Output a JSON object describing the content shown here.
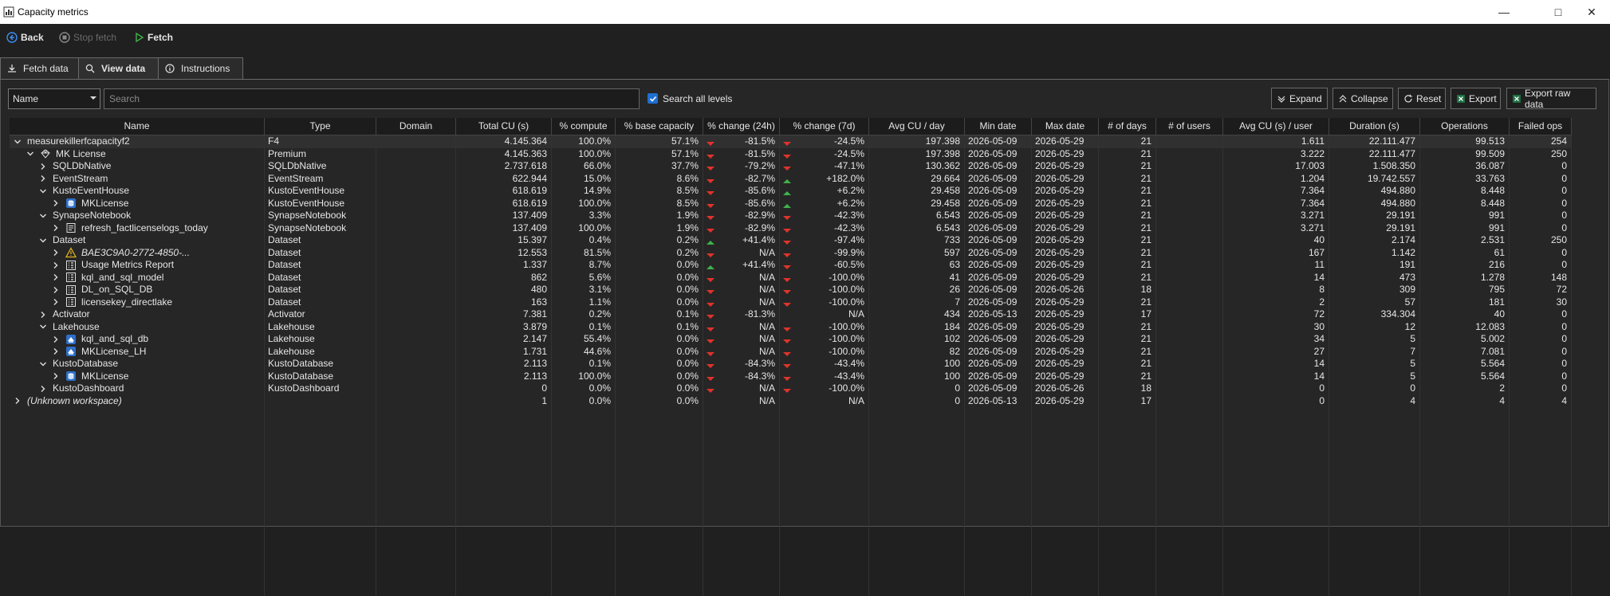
{
  "window": {
    "title": "Capacity metrics"
  },
  "toolbar": {
    "back": "Back",
    "stop_fetch": "Stop fetch",
    "fetch": "Fetch"
  },
  "tabs": [
    {
      "label": "Fetch data"
    },
    {
      "label": "View data"
    },
    {
      "label": "Instructions"
    }
  ],
  "filter": {
    "field": "Name",
    "search_placeholder": "Search",
    "search_all_levels_label": "Search all levels",
    "search_all_levels_checked": true
  },
  "actions": {
    "expand": "Expand",
    "collapse": "Collapse",
    "reset": "Reset",
    "export": "Export",
    "export_raw": "Export raw data"
  },
  "columns": [
    "Name",
    "Type",
    "Domain",
    "Total CU (s)",
    "% compute",
    "% base capacity",
    "% change (24h)",
    "% change (7d)",
    "Avg CU / day",
    "Min date",
    "Max date",
    "# of days",
    "# of users",
    "Avg CU (s) / user",
    "Duration (s)",
    "Operations",
    "Failed ops"
  ],
  "rows": [
    {
      "name": "measurekillerfcapacityf2",
      "type": "F4",
      "domain": "",
      "total_cu": "4.145.364",
      "pct_compute": "100.0%",
      "pct_base": "57.1%",
      "chg24": "-81.5%",
      "chg24_dir": "down",
      "chg7": "-24.5%",
      "chg7_dir": "down",
      "avg_cu_day": "197.398",
      "min_date": "2026-05-09",
      "max_date": "2026-05-29",
      "days": "21",
      "users": "",
      "avg_cu_user": "1.611",
      "duration": "22.111.477",
      "operations": "99.513",
      "failed": "254"
    },
    {
      "name": "MK License",
      "type": "Premium",
      "domain": "",
      "total_cu": "4.145.363",
      "pct_compute": "100.0%",
      "pct_base": "57.1%",
      "chg24": "-81.5%",
      "chg24_dir": "down",
      "chg7": "-24.5%",
      "chg7_dir": "down",
      "avg_cu_day": "197.398",
      "min_date": "2026-05-09",
      "max_date": "2026-05-29",
      "days": "21",
      "users": "",
      "avg_cu_user": "3.222",
      "duration": "22.111.477",
      "operations": "99.509",
      "failed": "250"
    },
    {
      "name": "SQLDbNative",
      "type": "SQLDbNative",
      "domain": "",
      "total_cu": "2.737.618",
      "pct_compute": "66.0%",
      "pct_base": "37.7%",
      "chg24": "-79.2%",
      "chg24_dir": "down",
      "chg7": "-47.1%",
      "chg7_dir": "down",
      "avg_cu_day": "130.362",
      "min_date": "2026-05-09",
      "max_date": "2026-05-29",
      "days": "21",
      "users": "",
      "avg_cu_user": "17.003",
      "duration": "1.508.350",
      "operations": "36.087",
      "failed": "0"
    },
    {
      "name": "EventStream",
      "type": "EventStream",
      "domain": "",
      "total_cu": "622.944",
      "pct_compute": "15.0%",
      "pct_base": "8.6%",
      "chg24": "-82.7%",
      "chg24_dir": "down",
      "chg7": "+182.0%",
      "chg7_dir": "up",
      "avg_cu_day": "29.664",
      "min_date": "2026-05-09",
      "max_date": "2026-05-29",
      "days": "21",
      "users": "",
      "avg_cu_user": "1.204",
      "duration": "19.742.557",
      "operations": "33.763",
      "failed": "0"
    },
    {
      "name": "KustoEventHouse",
      "type": "KustoEventHouse",
      "domain": "",
      "total_cu": "618.619",
      "pct_compute": "14.9%",
      "pct_base": "8.5%",
      "chg24": "-85.6%",
      "chg24_dir": "down",
      "chg7": "+6.2%",
      "chg7_dir": "up",
      "avg_cu_day": "29.458",
      "min_date": "2026-05-09",
      "max_date": "2026-05-29",
      "days": "21",
      "users": "",
      "avg_cu_user": "7.364",
      "duration": "494.880",
      "operations": "8.448",
      "failed": "0"
    },
    {
      "name": "MKLicense",
      "type": "KustoEventHouse",
      "domain": "",
      "total_cu": "618.619",
      "pct_compute": "100.0%",
      "pct_base": "8.5%",
      "chg24": "-85.6%",
      "chg24_dir": "down",
      "chg7": "+6.2%",
      "chg7_dir": "up",
      "avg_cu_day": "29.458",
      "min_date": "2026-05-09",
      "max_date": "2026-05-29",
      "days": "21",
      "users": "",
      "avg_cu_user": "7.364",
      "duration": "494.880",
      "operations": "8.448",
      "failed": "0"
    },
    {
      "name": "SynapseNotebook",
      "type": "SynapseNotebook",
      "domain": "",
      "total_cu": "137.409",
      "pct_compute": "3.3%",
      "pct_base": "1.9%",
      "chg24": "-82.9%",
      "chg24_dir": "down",
      "chg7": "-42.3%",
      "chg7_dir": "down",
      "avg_cu_day": "6.543",
      "min_date": "2026-05-09",
      "max_date": "2026-05-29",
      "days": "21",
      "users": "",
      "avg_cu_user": "3.271",
      "duration": "29.191",
      "operations": "991",
      "failed": "0"
    },
    {
      "name": "refresh_factlicenselogs_today",
      "type": "SynapseNotebook",
      "domain": "",
      "total_cu": "137.409",
      "pct_compute": "100.0%",
      "pct_base": "1.9%",
      "chg24": "-82.9%",
      "chg24_dir": "down",
      "chg7": "-42.3%",
      "chg7_dir": "down",
      "avg_cu_day": "6.543",
      "min_date": "2026-05-09",
      "max_date": "2026-05-29",
      "days": "21",
      "users": "",
      "avg_cu_user": "3.271",
      "duration": "29.191",
      "operations": "991",
      "failed": "0"
    },
    {
      "name": "Dataset",
      "type": "Dataset",
      "domain": "",
      "total_cu": "15.397",
      "pct_compute": "0.4%",
      "pct_base": "0.2%",
      "chg24": "+41.4%",
      "chg24_dir": "up",
      "chg7": "-97.4%",
      "chg7_dir": "down",
      "avg_cu_day": "733",
      "min_date": "2026-05-09",
      "max_date": "2026-05-29",
      "days": "21",
      "users": "",
      "avg_cu_user": "40",
      "duration": "2.174",
      "operations": "2.531",
      "failed": "250"
    },
    {
      "name": "BAE3C9A0-2772-4850-...",
      "type": "Dataset",
      "domain": "",
      "total_cu": "12.553",
      "pct_compute": "81.5%",
      "pct_base": "0.2%",
      "chg24": "N/A",
      "chg24_dir": "down",
      "chg7": "-99.9%",
      "chg7_dir": "down",
      "avg_cu_day": "597",
      "min_date": "2026-05-09",
      "max_date": "2026-05-29",
      "days": "21",
      "users": "",
      "avg_cu_user": "167",
      "duration": "1.142",
      "operations": "61",
      "failed": "0"
    },
    {
      "name": "Usage Metrics Report",
      "type": "Dataset",
      "domain": "",
      "total_cu": "1.337",
      "pct_compute": "8.7%",
      "pct_base": "0.0%",
      "chg24": "+41.4%",
      "chg24_dir": "up",
      "chg7": "-60.5%",
      "chg7_dir": "down",
      "avg_cu_day": "63",
      "min_date": "2026-05-09",
      "max_date": "2026-05-29",
      "days": "21",
      "users": "",
      "avg_cu_user": "11",
      "duration": "191",
      "operations": "216",
      "failed": "0"
    },
    {
      "name": "kql_and_sql_model",
      "type": "Dataset",
      "domain": "",
      "total_cu": "862",
      "pct_compute": "5.6%",
      "pct_base": "0.0%",
      "chg24": "N/A",
      "chg24_dir": "down",
      "chg7": "-100.0%",
      "chg7_dir": "down",
      "avg_cu_day": "41",
      "min_date": "2026-05-09",
      "max_date": "2026-05-29",
      "days": "21",
      "users": "",
      "avg_cu_user": "14",
      "duration": "473",
      "operations": "1.278",
      "failed": "148"
    },
    {
      "name": "DL_on_SQL_DB",
      "type": "Dataset",
      "domain": "",
      "total_cu": "480",
      "pct_compute": "3.1%",
      "pct_base": "0.0%",
      "chg24": "N/A",
      "chg24_dir": "down",
      "chg7": "-100.0%",
      "chg7_dir": "down",
      "avg_cu_day": "26",
      "min_date": "2026-05-09",
      "max_date": "2026-05-26",
      "days": "18",
      "users": "",
      "avg_cu_user": "8",
      "duration": "309",
      "operations": "795",
      "failed": "72"
    },
    {
      "name": "licensekey_directlake",
      "type": "Dataset",
      "domain": "",
      "total_cu": "163",
      "pct_compute": "1.1%",
      "pct_base": "0.0%",
      "chg24": "N/A",
      "chg24_dir": "down",
      "chg7": "-100.0%",
      "chg7_dir": "down",
      "avg_cu_day": "7",
      "min_date": "2026-05-09",
      "max_date": "2026-05-29",
      "days": "21",
      "users": "",
      "avg_cu_user": "2",
      "duration": "57",
      "operations": "181",
      "failed": "30"
    },
    {
      "name": "Activator",
      "type": "Activator",
      "domain": "",
      "total_cu": "7.381",
      "pct_compute": "0.2%",
      "pct_base": "0.1%",
      "chg24": "-81.3%",
      "chg24_dir": "down",
      "chg7": "N/A",
      "chg7_dir": "none",
      "avg_cu_day": "434",
      "min_date": "2026-05-13",
      "max_date": "2026-05-29",
      "days": "17",
      "users": "",
      "avg_cu_user": "72",
      "duration": "334.304",
      "operations": "40",
      "failed": "0"
    },
    {
      "name": "Lakehouse",
      "type": "Lakehouse",
      "domain": "",
      "total_cu": "3.879",
      "pct_compute": "0.1%",
      "pct_base": "0.1%",
      "chg24": "N/A",
      "chg24_dir": "down",
      "chg7": "-100.0%",
      "chg7_dir": "down",
      "avg_cu_day": "184",
      "min_date": "2026-05-09",
      "max_date": "2026-05-29",
      "days": "21",
      "users": "",
      "avg_cu_user": "30",
      "duration": "12",
      "operations": "12.083",
      "failed": "0"
    },
    {
      "name": "kql_and_sql_db",
      "type": "Lakehouse",
      "domain": "",
      "total_cu": "2.147",
      "pct_compute": "55.4%",
      "pct_base": "0.0%",
      "chg24": "N/A",
      "chg24_dir": "down",
      "chg7": "-100.0%",
      "chg7_dir": "down",
      "avg_cu_day": "102",
      "min_date": "2026-05-09",
      "max_date": "2026-05-29",
      "days": "21",
      "users": "",
      "avg_cu_user": "34",
      "duration": "5",
      "operations": "5.002",
      "failed": "0"
    },
    {
      "name": "MKLicense_LH",
      "type": "Lakehouse",
      "domain": "",
      "total_cu": "1.731",
      "pct_compute": "44.6%",
      "pct_base": "0.0%",
      "chg24": "N/A",
      "chg24_dir": "down",
      "chg7": "-100.0%",
      "chg7_dir": "down",
      "avg_cu_day": "82",
      "min_date": "2026-05-09",
      "max_date": "2026-05-29",
      "days": "21",
      "users": "",
      "avg_cu_user": "27",
      "duration": "7",
      "operations": "7.081",
      "failed": "0"
    },
    {
      "name": "KustoDatabase",
      "type": "KustoDatabase",
      "domain": "",
      "total_cu": "2.113",
      "pct_compute": "0.1%",
      "pct_base": "0.0%",
      "chg24": "-84.3%",
      "chg24_dir": "down",
      "chg7": "-43.4%",
      "chg7_dir": "down",
      "avg_cu_day": "100",
      "min_date": "2026-05-09",
      "max_date": "2026-05-29",
      "days": "21",
      "users": "",
      "avg_cu_user": "14",
      "duration": "5",
      "operations": "5.564",
      "failed": "0"
    },
    {
      "name": "MKLicense",
      "type": "KustoDatabase",
      "domain": "",
      "total_cu": "2.113",
      "pct_compute": "100.0%",
      "pct_base": "0.0%",
      "chg24": "-84.3%",
      "chg24_dir": "down",
      "chg7": "-43.4%",
      "chg7_dir": "down",
      "avg_cu_day": "100",
      "min_date": "2026-05-09",
      "max_date": "2026-05-29",
      "days": "21",
      "users": "",
      "avg_cu_user": "14",
      "duration": "5",
      "operations": "5.564",
      "failed": "0"
    },
    {
      "name": "KustoDashboard",
      "type": "KustoDashboard",
      "domain": "",
      "total_cu": "0",
      "pct_compute": "0.0%",
      "pct_base": "0.0%",
      "chg24": "N/A",
      "chg24_dir": "down",
      "chg7": "-100.0%",
      "chg7_dir": "down",
      "avg_cu_day": "0",
      "min_date": "2026-05-09",
      "max_date": "2026-05-26",
      "days": "18",
      "users": "",
      "avg_cu_user": "0",
      "duration": "0",
      "operations": "2",
      "failed": "0"
    },
    {
      "name": "(Unknown workspace)",
      "type": "",
      "domain": "",
      "total_cu": "1",
      "pct_compute": "0.0%",
      "pct_base": "0.0%",
      "chg24": "N/A",
      "chg24_dir": "none",
      "chg7": "N/A",
      "chg7_dir": "none",
      "avg_cu_day": "0",
      "min_date": "2026-05-13",
      "max_date": "2026-05-29",
      "days": "17",
      "users": "",
      "avg_cu_user": "0",
      "duration": "4",
      "operations": "4",
      "failed": "4"
    }
  ],
  "tree": [
    {
      "level": 0,
      "expanded": true,
      "icon": "none"
    },
    {
      "level": 1,
      "expanded": true,
      "icon": "diamond-icon"
    },
    {
      "level": 2,
      "expanded": false,
      "icon": "none"
    },
    {
      "level": 2,
      "expanded": false,
      "icon": "none"
    },
    {
      "level": 2,
      "expanded": true,
      "icon": "none"
    },
    {
      "level": 3,
      "expanded": false,
      "icon": "kql-db-icon"
    },
    {
      "level": 2,
      "expanded": true,
      "icon": "none"
    },
    {
      "level": 3,
      "expanded": false,
      "icon": "notebook-icon"
    },
    {
      "level": 2,
      "expanded": true,
      "icon": "none"
    },
    {
      "level": 3,
      "expanded": false,
      "icon": "warning-icon"
    },
    {
      "level": 3,
      "expanded": false,
      "icon": "semantic-model-icon"
    },
    {
      "level": 3,
      "expanded": false,
      "icon": "semantic-model-icon"
    },
    {
      "level": 3,
      "expanded": false,
      "icon": "semantic-model-icon"
    },
    {
      "level": 3,
      "expanded": false,
      "icon": "semantic-model-icon"
    },
    {
      "level": 2,
      "expanded": false,
      "icon": "none"
    },
    {
      "level": 2,
      "expanded": true,
      "icon": "none"
    },
    {
      "level": 3,
      "expanded": false,
      "icon": "lakehouse-icon"
    },
    {
      "level": 3,
      "expanded": false,
      "icon": "lakehouse-icon"
    },
    {
      "level": 2,
      "expanded": true,
      "icon": "none"
    },
    {
      "level": 3,
      "expanded": false,
      "icon": "kql-db-icon"
    },
    {
      "level": 2,
      "expanded": false,
      "icon": "none"
    },
    {
      "level": 0,
      "expanded": false,
      "icon": "none",
      "italic": true
    }
  ],
  "colors": {
    "up": "#3fb24a",
    "down": "#e0332b",
    "accent": "#1f6fd1"
  }
}
